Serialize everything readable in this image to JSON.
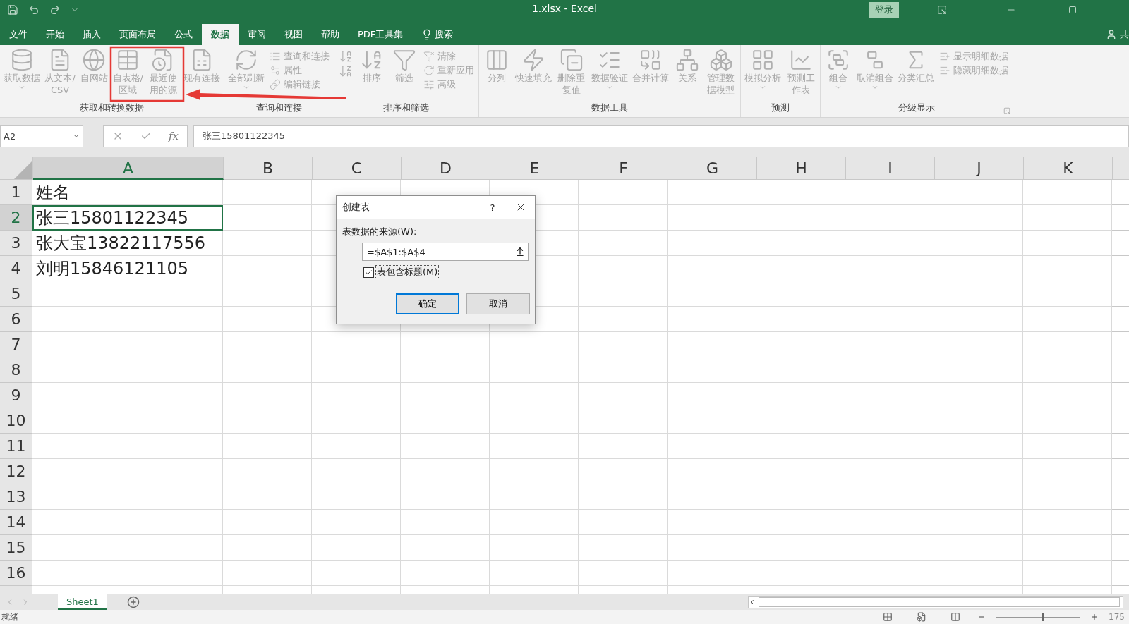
{
  "window": {
    "title": "1.xlsx  -  Excel",
    "login": "登录",
    "account": "共"
  },
  "tabs": [
    {
      "label": "文件",
      "selected": false
    },
    {
      "label": "开始",
      "selected": false
    },
    {
      "label": "插入",
      "selected": false
    },
    {
      "label": "页面布局",
      "selected": false
    },
    {
      "label": "公式",
      "selected": false
    },
    {
      "label": "数据",
      "selected": true
    },
    {
      "label": "审阅",
      "selected": false
    },
    {
      "label": "视图",
      "selected": false
    },
    {
      "label": "帮助",
      "selected": false
    },
    {
      "label": "PDF工具集",
      "selected": false
    },
    {
      "label": "搜索",
      "selected": false
    }
  ],
  "ribbon": {
    "groups": [
      {
        "label": "获取和转换数据",
        "launcher": false,
        "items": [
          {
            "kind": "large",
            "label": "获取数据",
            "dropdown": true,
            "disabled": true
          },
          {
            "kind": "large",
            "label": "从文本/CSV",
            "dropdown": false,
            "disabled": true
          },
          {
            "kind": "large",
            "label": "自网站",
            "dropdown": false,
            "disabled": true
          },
          {
            "kind": "large",
            "label": "自表格/区域",
            "dropdown": false,
            "disabled": true
          },
          {
            "kind": "large",
            "label": "最近使用的源",
            "dropdown": false,
            "disabled": true
          },
          {
            "kind": "large",
            "label": "现有连接",
            "dropdown": false,
            "disabled": true
          }
        ]
      },
      {
        "label": "查询和连接",
        "launcher": false,
        "items": [
          {
            "kind": "large",
            "label": "全部刷新",
            "dropdown": true,
            "disabled": true
          },
          {
            "kind": "stack",
            "buttons": [
              {
                "label": "查询和连接",
                "disabled": true
              },
              {
                "label": "属性",
                "disabled": true
              },
              {
                "label": "编辑链接",
                "disabled": true
              }
            ]
          }
        ]
      },
      {
        "label": "排序和筛选",
        "launcher": false,
        "items": [
          {
            "kind": "sort",
            "disabled": true
          },
          {
            "kind": "large",
            "label": "排序",
            "dropdown": false,
            "disabled": true
          },
          {
            "kind": "large",
            "label": "筛选",
            "dropdown": false,
            "disabled": true
          },
          {
            "kind": "stack",
            "buttons": [
              {
                "label": "清除",
                "disabled": true
              },
              {
                "label": "重新应用",
                "disabled": true
              },
              {
                "label": "高级",
                "disabled": true
              }
            ]
          }
        ]
      },
      {
        "label": "数据工具",
        "launcher": false,
        "items": [
          {
            "kind": "large",
            "label": "分列",
            "dropdown": false,
            "disabled": true
          },
          {
            "kind": "large",
            "label": "快速填充",
            "dropdown": false,
            "disabled": true
          },
          {
            "kind": "large",
            "label": "删除重复值",
            "dropdown": false,
            "disabled": true
          },
          {
            "kind": "large",
            "label": "数据验证",
            "dropdown": true,
            "disabled": true
          },
          {
            "kind": "large",
            "label": "合并计算",
            "dropdown": false,
            "disabled": true
          },
          {
            "kind": "large",
            "label": "关系",
            "dropdown": false,
            "disabled": true
          },
          {
            "kind": "large",
            "label": "管理数据模型",
            "dropdown": false,
            "disabled": true
          }
        ]
      },
      {
        "label": "预测",
        "launcher": false,
        "items": [
          {
            "kind": "large",
            "label": "模拟分析",
            "dropdown": true,
            "disabled": true
          },
          {
            "kind": "large",
            "label": "预测工作表",
            "dropdown": false,
            "disabled": true
          }
        ]
      },
      {
        "label": "分级显示",
        "launcher": true,
        "items": [
          {
            "kind": "large",
            "label": "组合",
            "dropdown": true,
            "disabled": true
          },
          {
            "kind": "large",
            "label": "取消组合",
            "dropdown": true,
            "disabled": true
          },
          {
            "kind": "large",
            "label": "分类汇总",
            "dropdown": false,
            "disabled": true
          },
          {
            "kind": "stack",
            "buttons": [
              {
                "label": "显示明细数据",
                "disabled": true
              },
              {
                "label": "隐藏明细数据",
                "disabled": true
              }
            ]
          }
        ]
      }
    ]
  },
  "formula_bar": {
    "name_box": "A2",
    "fx": "fx",
    "formula": "张三15801122345"
  },
  "sheet": {
    "columns": [
      {
        "label": "A",
        "selected": true
      },
      {
        "label": "B",
        "selected": false
      },
      {
        "label": "C",
        "selected": false
      },
      {
        "label": "D",
        "selected": false
      },
      {
        "label": "E",
        "selected": false
      },
      {
        "label": "F",
        "selected": false
      },
      {
        "label": "G",
        "selected": false
      },
      {
        "label": "H",
        "selected": false
      },
      {
        "label": "I",
        "selected": false
      },
      {
        "label": "J",
        "selected": false
      },
      {
        "label": "K",
        "selected": false
      }
    ],
    "rows": [
      {
        "label": "1",
        "selected": false,
        "cells": [
          {
            "text": "姓名",
            "active": false
          }
        ]
      },
      {
        "label": "2",
        "selected": true,
        "cells": [
          {
            "text": "张三15801122345",
            "active": true
          }
        ]
      },
      {
        "label": "3",
        "selected": false,
        "cells": [
          {
            "text": "张大宝13822117556",
            "active": false
          }
        ]
      },
      {
        "label": "4",
        "selected": false,
        "cells": [
          {
            "text": "刘明15846121105",
            "active": false
          }
        ]
      },
      {
        "label": "5",
        "selected": false
      },
      {
        "label": "6",
        "selected": false
      },
      {
        "label": "7",
        "selected": false
      },
      {
        "label": "8",
        "selected": false
      },
      {
        "label": "9",
        "selected": false
      },
      {
        "label": "10",
        "selected": false
      },
      {
        "label": "11",
        "selected": false
      },
      {
        "label": "12",
        "selected": false
      },
      {
        "label": "13",
        "selected": false
      },
      {
        "label": "14",
        "selected": false
      },
      {
        "label": "15",
        "selected": false
      },
      {
        "label": "16",
        "selected": false
      }
    ]
  },
  "dialog": {
    "title": "创建表",
    "help": "?",
    "source_label": "表数据的来源(W):",
    "source_value": "=$A$1:$A$4",
    "has_headers": {
      "label": "表包含标题(M)",
      "checked": true
    },
    "buttons": [
      {
        "label": "确定",
        "default": true
      },
      {
        "label": "取消",
        "default": false
      }
    ]
  },
  "sheet_tabs": [
    {
      "label": "Sheet1",
      "selected": true
    }
  ],
  "status_bar": {
    "status": "就绪",
    "zoom": {
      "level": 0.55,
      "reading": "175"
    }
  }
}
